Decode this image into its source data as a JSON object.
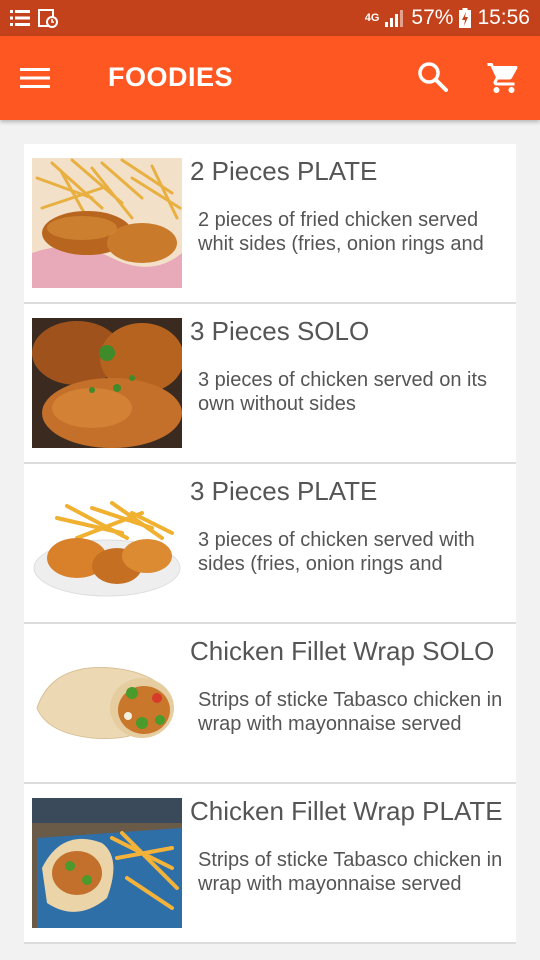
{
  "status": {
    "network": "4G",
    "battery": "57%",
    "time": "15:56"
  },
  "app": {
    "title": "FOODIES"
  },
  "icons": {
    "menu": "menu-icon",
    "search": "search-icon",
    "cart": "cart-icon"
  },
  "colors": {
    "primary": "#ff5722",
    "statusbar": "#c4421b"
  },
  "items": [
    {
      "title": "2 Pieces PLATE",
      "description": "2 pieces of fried chicken served whit sides (fries, onion rings and"
    },
    {
      "title": "3 Pieces SOLO",
      "description": "3 pieces of chicken served on its own without sides"
    },
    {
      "title": "3 Pieces PLATE",
      "description": "3 pieces of chicken served with sides (fries, onion rings and"
    },
    {
      "title": "Chicken Fillet Wrap SOLO",
      "description": "Strips of sticke Tabasco chicken in wrap with mayonnaise served"
    },
    {
      "title": "Chicken Fillet Wrap PLATE",
      "description": "Strips of sticke Tabasco chicken in wrap with mayonnaise served"
    }
  ]
}
